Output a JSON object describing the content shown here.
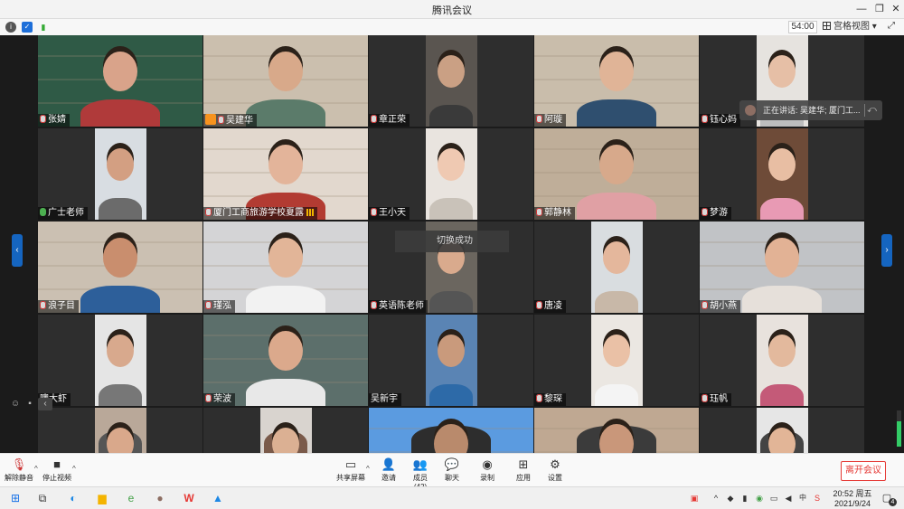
{
  "window": {
    "title": "腾讯会议"
  },
  "infobar": {
    "timer": "54:00",
    "view_mode": "宫格视图",
    "view_caret": "▾",
    "fullscreen": "⤢",
    "info_icon": "info-icon",
    "shield_icon": "shield-icon",
    "signal_icon": "signal-icon"
  },
  "tiles": [
    {
      "name": "张婧",
      "mic": "muted",
      "bg": "#355b45",
      "video": "#2f5a46",
      "skin": "#d9a38a",
      "shirt": "#b03a3a"
    },
    {
      "name": "吴建华",
      "mic": "muted",
      "host": true,
      "bg": "#d6cec2",
      "video": "#cbbfae",
      "skin": "#d8a98a",
      "shirt": "#5b7b6a"
    },
    {
      "name": "章正荣",
      "mic": "muted",
      "bg": "#2e2e2e",
      "video": "#5a5550",
      "narrow": true,
      "skin": "#caa084",
      "shirt": "#3a3a3a"
    },
    {
      "name": "阿璇",
      "mic": "muted",
      "bg": "#d2c7b8",
      "video": "#c9bdab",
      "skin": "#e0b497",
      "shirt": "#2f4f6f"
    },
    {
      "name": "钰心妈",
      "mic": "muted",
      "bg": "#2e2e2e",
      "video": "#e6e3df",
      "narrow": true,
      "skin": "#e6bfa6",
      "shirt": "#bdbdbd"
    },
    {
      "name": "广士老师",
      "mic": "on",
      "bg": "#2e2e2e",
      "video": "#d8dde2",
      "narrow": true,
      "skin": "#d39f82",
      "shirt": "#6b6b6b"
    },
    {
      "name": "厦门工商旅游学校夏露",
      "mic": "muted",
      "signal": true,
      "bg": "#e5dcd3",
      "video": "#e2d8ce",
      "skin": "#e3b49a",
      "shirt": "#b23b32"
    },
    {
      "name": "王小天",
      "mic": "muted",
      "bg": "#2e2e2e",
      "video": "#e9e4df",
      "narrow": true,
      "skin": "#efc9b2",
      "shirt": "#c9c2b9"
    },
    {
      "name": "郭静林",
      "mic": "muted",
      "bg": "#c9b9a8",
      "video": "#bfae99",
      "skin": "#d7a98b",
      "shirt": "#e0a0a4"
    },
    {
      "name": "梦游",
      "mic": "muted",
      "bg": "#2e2e2e",
      "video": "#6e4b38",
      "narrow": true,
      "skin": "#e8bea3",
      "shirt": "#e89ab4"
    },
    {
      "name": "浪子目",
      "mic": "muted",
      "bg": "#d4cbbf",
      "video": "#cbc0b2",
      "skin": "#c98e6e",
      "shirt": "#2d5f9a"
    },
    {
      "name": "瑾泓",
      "mic": "muted",
      "bg": "#dcdcdc",
      "video": "#d4d4d6",
      "skin": "#e2b598",
      "shirt": "#f2f2f2"
    },
    {
      "name": "英语陈老师",
      "mic": "muted",
      "bg": "#2e2e2e",
      "video": "#6b665f",
      "narrow": true,
      "skin": "#d9aa8d",
      "shirt": "#555"
    },
    {
      "name": "唐凌",
      "mic": "muted",
      "bg": "#2e2e2e",
      "video": "#d9dde0",
      "narrow": true,
      "skin": "#e4b79c",
      "shirt": "#c8b8a8"
    },
    {
      "name": "胡小燕",
      "mic": "muted",
      "bg": "#c7c9cb",
      "video": "#c1c3c6",
      "skin": "#e2b295",
      "shirt": "#e6e0da"
    },
    {
      "name": "噢大虾",
      "mic": "none",
      "bg": "#2e2e2e",
      "video": "#e5e5e5",
      "narrow": true,
      "skin": "#d8a98d",
      "shirt": "#777"
    },
    {
      "name": "荣波",
      "mic": "muted",
      "bg": "#4f6a6a",
      "video": "#5c6f6b",
      "skin": "#dba98c",
      "shirt": "#e8e8e8"
    },
    {
      "name": "吴新宇",
      "mic": "none",
      "bg": "#2e2e2e",
      "video": "#5a84b4",
      "narrow": true,
      "skin": "#c99a7c",
      "shirt": "#2d6aa8"
    },
    {
      "name": "黎琛",
      "mic": "muted",
      "bg": "#2e2e2e",
      "video": "#ebe7e2",
      "narrow": true,
      "skin": "#eac1a6",
      "shirt": "#f4f4f4"
    },
    {
      "name": "珏帆",
      "mic": "muted",
      "bg": "#2e2e2e",
      "video": "#e8e2dd",
      "narrow": true,
      "skin": "#e3b99d",
      "shirt": "#c45a78"
    },
    {
      "name": "",
      "mic": "none",
      "bg": "#2e2e2e",
      "video": "#b9a899",
      "narrow": true,
      "skin": "#d9a88b",
      "shirt": "#555"
    },
    {
      "name": "",
      "mic": "none",
      "bg": "#2e2e2e",
      "video": "#d9d4cf",
      "narrow": true,
      "skin": "#dbb093",
      "shirt": "#7a5a4a"
    },
    {
      "name": "",
      "mic": "none",
      "bg": "#4a8fdc",
      "video": "#5b9be0",
      "skin": "#b98a6c",
      "shirt": "#2d2d2d"
    },
    {
      "name": "",
      "mic": "none",
      "bg": "#c9b7a3",
      "video": "#bfa892",
      "skin": "#c9977a",
      "shirt": "#3b3b3b"
    },
    {
      "name": "",
      "mic": "none",
      "bg": "#2e2e2e",
      "video": "#e6e6e6",
      "narrow": true,
      "skin": "#e2b597",
      "shirt": "#444"
    }
  ],
  "toast": "切换成功",
  "speaking": {
    "text": "正在讲话: 吴建华; 厦门工...",
    "back": "⤺"
  },
  "sidebar_arrows": {
    "left": "‹",
    "right": "›"
  },
  "side_buttons": {
    "emoji": "☺",
    "chat": "▪",
    "collapse": "‹"
  },
  "toolbar": {
    "mute": "解除静音",
    "video": "停止视频",
    "share": "共享屏幕",
    "invite": "邀请",
    "members": "成员(42)",
    "chat": "聊天",
    "record": "录制",
    "apps": "应用",
    "settings": "设置",
    "leave": "离开会议",
    "caret": "^"
  },
  "taskbar": {
    "time": "20:52 周五",
    "date": "2021/9/24",
    "notifications": "4",
    "colors": {
      "start": "#1a73e8",
      "edge": "#1e88e5",
      "files": "#f4b400",
      "ie": "#43a047",
      "wps": "#e53935",
      "meeting": "#1e88e5"
    }
  }
}
